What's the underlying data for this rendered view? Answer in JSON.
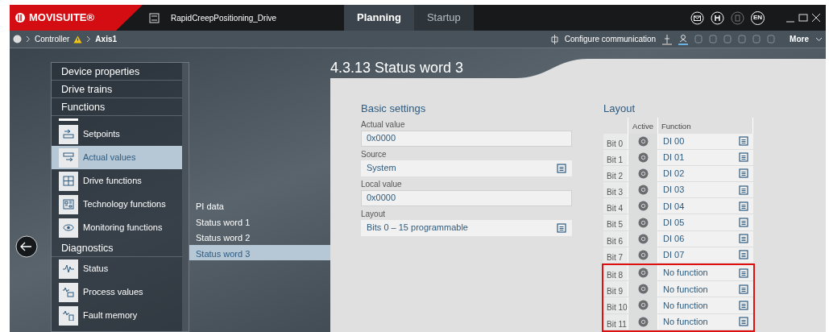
{
  "app": {
    "logo": "MOVISUITE®",
    "project": "RapidCreepPositioning_Drive",
    "language": "EN"
  },
  "tabs": [
    {
      "label": "Planning",
      "selected": true
    },
    {
      "label": "Startup",
      "selected": false
    }
  ],
  "breadcrumb": [
    {
      "label": "Controller",
      "warning": true,
      "current": false
    },
    {
      "label": "Axis1",
      "warning": false,
      "current": true
    }
  ],
  "toolbar": {
    "configure": "Configure communication",
    "more": "More"
  },
  "nav": [
    {
      "title": "Device properties"
    },
    {
      "title": "Drive trains"
    },
    {
      "title": "Functions",
      "items": [
        {
          "label": "Setpoints",
          "kind": "input",
          "selected": false
        },
        {
          "label": "Actual values",
          "kind": "output",
          "selected": true
        },
        {
          "label": "Drive functions",
          "kind": "grid",
          "selected": false
        },
        {
          "label": "Technology functions",
          "kind": "blocks",
          "selected": false
        },
        {
          "label": "Monitoring functions",
          "kind": "eye",
          "selected": false
        }
      ]
    },
    {
      "title": "Diagnostics",
      "items": [
        {
          "label": "Status",
          "kind": "pulse",
          "selected": false
        },
        {
          "label": "Process values",
          "kind": "chart",
          "selected": false
        },
        {
          "label": "Fault memory",
          "kind": "log",
          "selected": false
        }
      ]
    }
  ],
  "sublist": [
    {
      "label": "PI data",
      "selected": false
    },
    {
      "label": "Status word 1",
      "selected": false
    },
    {
      "label": "Status word 2",
      "selected": false
    },
    {
      "label": "Status word 3",
      "selected": true
    }
  ],
  "page": {
    "title": "4.3.13 Status word 3",
    "basic": {
      "heading": "Basic settings",
      "fields": [
        {
          "label": "Actual value",
          "value": "0x0000",
          "kind": "readonly"
        },
        {
          "label": "Source",
          "value": "System",
          "kind": "select"
        },
        {
          "label": "Local value",
          "value": "0x0000",
          "kind": "readonly"
        },
        {
          "label": "Layout",
          "value": "Bits 0 – 15 programmable",
          "kind": "select"
        }
      ]
    },
    "layout": {
      "heading": "Layout",
      "columns": [
        "Active",
        "Function"
      ],
      "rows": [
        {
          "bit": "Bit 0",
          "function": "DI 00",
          "highlighted": false
        },
        {
          "bit": "Bit 1",
          "function": "DI 01",
          "highlighted": false
        },
        {
          "bit": "Bit 2",
          "function": "DI 02",
          "highlighted": false
        },
        {
          "bit": "Bit 3",
          "function": "DI 03",
          "highlighted": false
        },
        {
          "bit": "Bit 4",
          "function": "DI 04",
          "highlighted": false
        },
        {
          "bit": "Bit 5",
          "function": "DI 05",
          "highlighted": false
        },
        {
          "bit": "Bit 6",
          "function": "DI 06",
          "highlighted": false
        },
        {
          "bit": "Bit 7",
          "function": "DI 07",
          "highlighted": false
        },
        {
          "bit": "Bit 8",
          "function": "No function",
          "highlighted": true
        },
        {
          "bit": "Bit 9",
          "function": "No function",
          "highlighted": true
        },
        {
          "bit": "Bit 10",
          "function": "No function",
          "highlighted": true
        },
        {
          "bit": "Bit 11",
          "function": "No function",
          "highlighted": true
        }
      ]
    }
  }
}
